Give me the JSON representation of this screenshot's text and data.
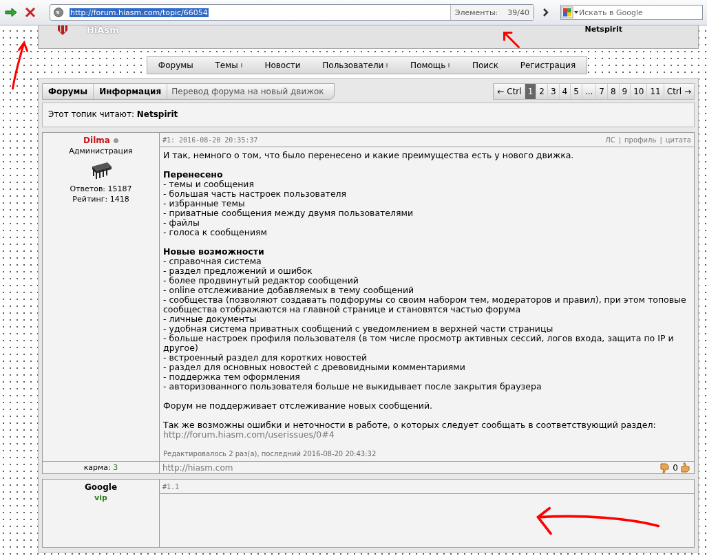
{
  "browser": {
    "address": "http://forum.hiasm.com/topic/66054",
    "elements_label": "Элементы:",
    "elements_count": "39/40",
    "search_placeholder": "Искать в Google"
  },
  "header": {
    "logo": "HiAsm",
    "user": "Netspirit"
  },
  "nav": [
    {
      "label": "Форумы",
      "dropdown": false
    },
    {
      "label": "Темы",
      "dropdown": true
    },
    {
      "label": "Новости",
      "dropdown": false
    },
    {
      "label": "Пользователи",
      "dropdown": true
    },
    {
      "label": "Помощь",
      "dropdown": true
    },
    {
      "label": "Поиск",
      "dropdown": false
    },
    {
      "label": "Регистрация",
      "dropdown": false
    }
  ],
  "breadcrumbs": [
    "Форумы",
    "Информация"
  ],
  "topic_title": "Перевод форума на новый движок",
  "pagination": {
    "prev": "← Ctrl",
    "next": "Ctrl →",
    "pages": [
      {
        "label": "1",
        "selected": true
      },
      {
        "label": "2",
        "selected": false
      },
      {
        "label": "3",
        "selected": false
      },
      {
        "label": "4",
        "selected": false
      },
      {
        "label": "5",
        "selected": false
      },
      {
        "label": "...",
        "selected": false
      },
      {
        "label": "7",
        "selected": false
      },
      {
        "label": "8",
        "selected": false
      },
      {
        "label": "9",
        "selected": false
      },
      {
        "label": "10",
        "selected": false
      },
      {
        "label": "11",
        "selected": false
      }
    ]
  },
  "readers": {
    "label": "Этот топик читают:",
    "names": "Netspirit"
  },
  "posts": [
    {
      "author": "Dilma",
      "online": false,
      "role": "Администрация",
      "avatar": {
        "kind": "chip"
      },
      "stats": [
        "Ответов: 15187",
        "Рейтинг: 1418"
      ],
      "karma_label": "карма:",
      "karma": "3",
      "number": "#1: 2016-08-20 20:35:37",
      "actions": [
        "ЛС",
        "профиль",
        "цитата"
      ],
      "action_separator": "|",
      "body": [
        {
          "kind": "text",
          "text": "И так, немного о том, что было перенесено и какие преимущества есть у нового движка."
        },
        {
          "kind": "list",
          "title": "Перенесено",
          "items": [
            "- темы и сообщения",
            "- большая часть настроек пользователя",
            "- избранные темы",
            "- приватные сообщения между двумя пользователями",
            "- файлы",
            "- голоса к сообщениям"
          ]
        },
        {
          "kind": "list",
          "title": "Новые возможности",
          "items": [
            "- справочная система",
            "- раздел предложений и ошибок",
            "- более продвинутый редактор сообщений",
            "- online отслеживание добавляемых в тему сообщений",
            "- сообщества (позволяют создавать подфорумы со своим набором тем, модераторов и правил), при этом топовые сообщества отображаются на главной странице и становятся частью форума",
            "- личные документы",
            "- удобная система приватных сообщений с уведомлением в верхней части страницы",
            "- больше настроек профиля пользователя (в том числе просмотр активных сессий, логов входа, защита по IP и другое)",
            "- встроенный раздел для коротких новостей",
            "- раздел для основных новостей с древовидными комментариями",
            "- поддержка тем оформления",
            "- авторизованного пользователя больше не выкидывает после закрытия браузера"
          ]
        },
        {
          "kind": "text",
          "text": "Форум не поддерживает отслеживание новых сообщений."
        },
        {
          "kind": "link_text",
          "text": "Так же возможны ошибки и неточности в работе, о которых следует сообщать в соответствующий раздел:",
          "link": "http://forum.hiasm.com/userissues/0#4"
        }
      ],
      "edited": "Редактировалось 2 раз(а), последний 2016-08-20 20:43:32",
      "signature": "http://hiasm.com",
      "votes": "0"
    },
    {
      "author": "Google",
      "role": "vip",
      "number": "#1.1"
    }
  ]
}
